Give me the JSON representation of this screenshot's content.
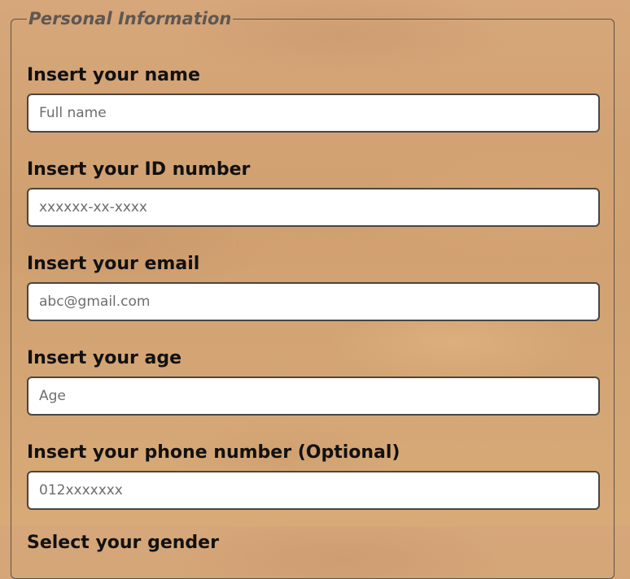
{
  "section": {
    "title": "Personal Information"
  },
  "fields": [
    {
      "label": "Insert your name",
      "placeholder": "Full name",
      "value": ""
    },
    {
      "label": "Insert your ID number",
      "placeholder": "xxxxxx-xx-xxxx",
      "value": ""
    },
    {
      "label": "Insert your email",
      "placeholder": "abc@gmail.com",
      "value": ""
    },
    {
      "label": "Insert your age",
      "placeholder": "Age",
      "value": ""
    },
    {
      "label": "Insert your phone number (Optional)",
      "placeholder": "012xxxxxxx",
      "value": ""
    }
  ],
  "gender": {
    "label": "Select your gender"
  },
  "colors": {
    "background": "#d4a574",
    "border": "#5c5248",
    "legend": "#5f5752",
    "input_bg": "#ffffff"
  }
}
